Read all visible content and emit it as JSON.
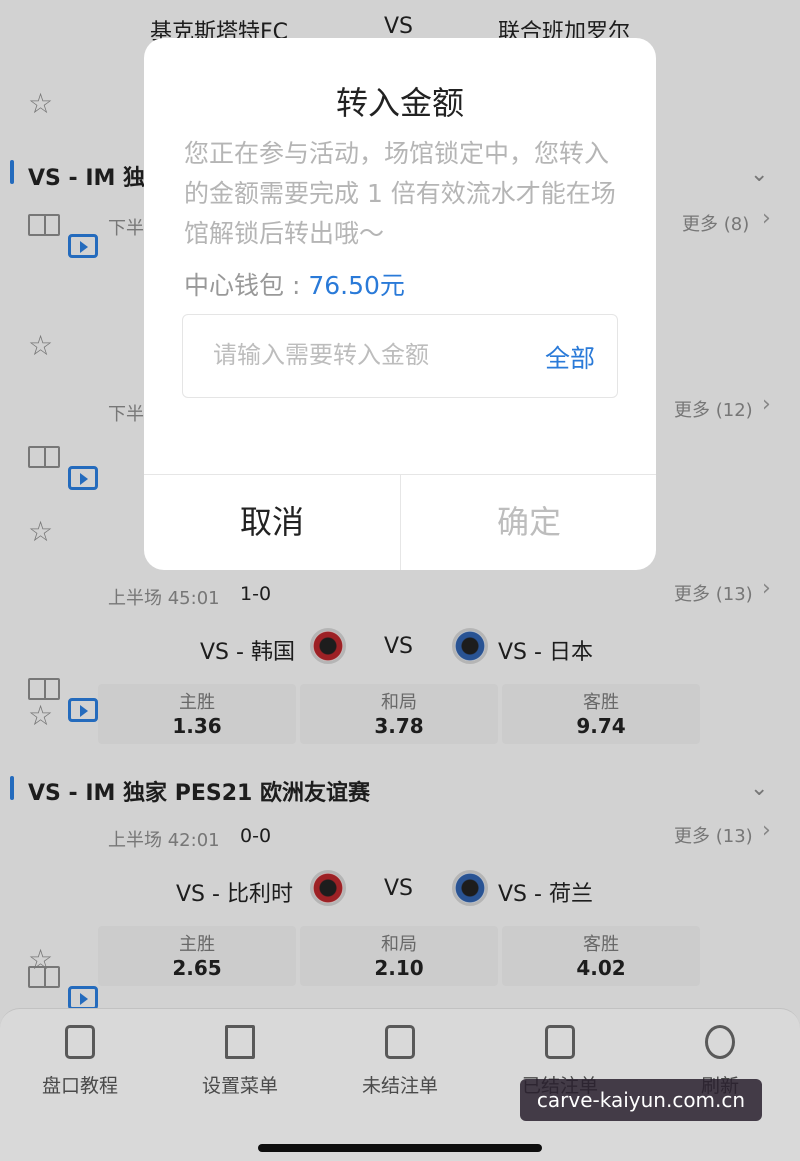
{
  "top_match": {
    "home": "基克斯塔特FC",
    "vs": "VS",
    "away": "联合班加罗尔"
  },
  "league1": {
    "title": "VS - IM 独家"
  },
  "match_b": {
    "time": "下半",
    "more": "更多 (8)"
  },
  "match_c": {
    "time": "下半",
    "more": "更多 (12)"
  },
  "match_d": {
    "time": "上半场 45:01",
    "score": "1-0",
    "more": "更多 (13)",
    "home": "VS - 韩国",
    "vs": "VS",
    "away": "VS - 日本",
    "odds": [
      {
        "label": "主胜",
        "value": "1.36"
      },
      {
        "label": "和局",
        "value": "3.78"
      },
      {
        "label": "客胜",
        "value": "9.74"
      }
    ]
  },
  "league2": {
    "title": "VS - IM 独家 PES21 欧洲友谊赛"
  },
  "match_e": {
    "time": "上半场 42:01",
    "score": "0-0",
    "more": "更多 (13)",
    "home": "VS - 比利时",
    "vs": "VS",
    "away": "VS - 荷兰",
    "odds": [
      {
        "label": "主胜",
        "value": "2.65"
      },
      {
        "label": "和局",
        "value": "2.10"
      },
      {
        "label": "客胜",
        "value": "4.02"
      }
    ]
  },
  "bottom_nav": [
    {
      "label": "盘口教程",
      "icon": "document-icon"
    },
    {
      "label": "设置菜单",
      "icon": "sliders-icon"
    },
    {
      "label": "未结注单",
      "icon": "clipboard-icon"
    },
    {
      "label": "已结注单",
      "icon": "yen-clipboard-icon"
    },
    {
      "label": "刷新",
      "icon": "refresh-icon"
    }
  ],
  "dialog": {
    "title": "转入金额",
    "message": "您正在参与活动，场馆锁定中，您转入的金额需要完成 1 倍有效流水才能在场馆解锁后转出哦～",
    "wallet_label": "中心钱包 : ",
    "wallet_amount": "76.50元",
    "input_placeholder": "请输入需要转入金额",
    "all_label": "全部",
    "cancel_label": "取消",
    "confirm_label": "确定"
  },
  "watermark": "carve-kaiyun.com.cn",
  "colors": {
    "accent": "#2a7ad8",
    "disabled": "#bdbdbd"
  }
}
